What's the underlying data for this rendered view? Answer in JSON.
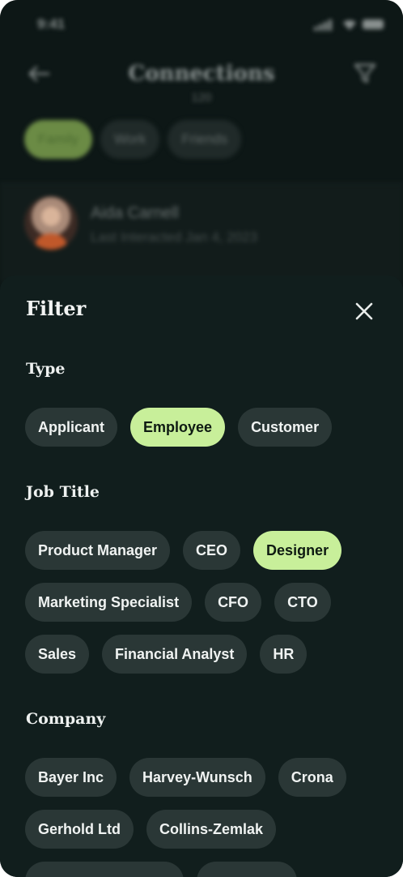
{
  "status_bar": {
    "time": "9:41"
  },
  "background": {
    "title": "Connections",
    "count": "120",
    "tabs": [
      {
        "label": "Family",
        "active": true
      },
      {
        "label": "Work",
        "active": false
      },
      {
        "label": "Friends",
        "active": false
      }
    ],
    "contacts": [
      {
        "name": "Aida Carnell",
        "subtitle": "Last Interacted Jan 4, 2023"
      }
    ]
  },
  "filter": {
    "title": "Filter",
    "sections": [
      {
        "label": "Type",
        "options": [
          {
            "label": "Applicant",
            "selected": false
          },
          {
            "label": "Employee",
            "selected": true
          },
          {
            "label": "Customer",
            "selected": false
          }
        ]
      },
      {
        "label": "Job Title",
        "options": [
          {
            "label": "Product Manager",
            "selected": false
          },
          {
            "label": "CEO",
            "selected": false
          },
          {
            "label": "Designer",
            "selected": true
          },
          {
            "label": "Marketing Specialist",
            "selected": false
          },
          {
            "label": "CFO",
            "selected": false
          },
          {
            "label": "CTO",
            "selected": false
          },
          {
            "label": "Sales",
            "selected": false
          },
          {
            "label": "Financial Analyst",
            "selected": false
          },
          {
            "label": "HR",
            "selected": false
          }
        ]
      },
      {
        "label": "Company",
        "options": [
          {
            "label": "Bayer Inc",
            "selected": false
          },
          {
            "label": "Harvey-Wunsch",
            "selected": false
          },
          {
            "label": "Crona",
            "selected": false
          },
          {
            "label": "Gerhold Ltd",
            "selected": false
          },
          {
            "label": "Collins-Zemlak",
            "selected": false
          }
        ]
      }
    ]
  },
  "colors": {
    "sheet_bg": "#111e1d",
    "chip_bg": "#2a3736",
    "chip_selected_bg": "#c8ef9a",
    "chip_selected_text": "#0e1a12"
  }
}
